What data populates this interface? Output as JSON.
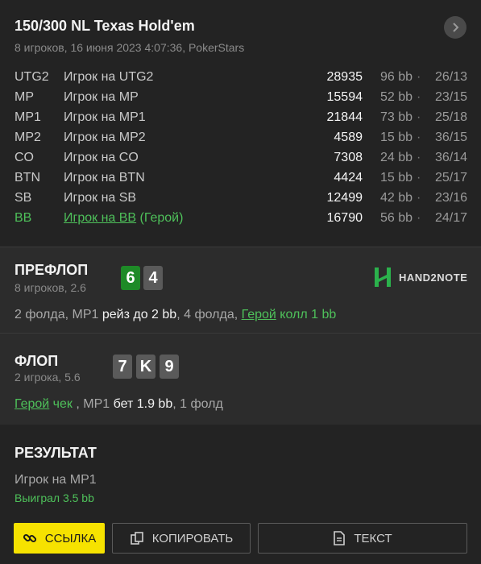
{
  "header": {
    "title": "150/300 NL Texas Hold'em",
    "subtitle": "8 игроков, 16 июня 2023 4:07:36, PokerStars",
    "next_icon": "chevron-right-icon"
  },
  "players": [
    {
      "pos": "UTG2",
      "name": "Игрок на UTG2",
      "hero_tag": "",
      "stack": "28935",
      "bb": "96 bb",
      "stat": "26/13"
    },
    {
      "pos": "MP",
      "name": "Игрок на MP",
      "hero_tag": "",
      "stack": "15594",
      "bb": "52 bb",
      "stat": "23/15"
    },
    {
      "pos": "MP1",
      "name": "Игрок на MP1",
      "hero_tag": "",
      "stack": "21844",
      "bb": "73 bb",
      "stat": "25/18"
    },
    {
      "pos": "MP2",
      "name": "Игрок на MP2",
      "hero_tag": "",
      "stack": "4589",
      "bb": "15 bb",
      "stat": "36/15"
    },
    {
      "pos": "CO",
      "name": "Игрок на CO",
      "hero_tag": "",
      "stack": "7308",
      "bb": "24 bb",
      "stat": "36/14"
    },
    {
      "pos": "BTN",
      "name": "Игрок на BTN",
      "hero_tag": "",
      "stack": "4424",
      "bb": "15 bb",
      "stat": "25/17"
    },
    {
      "pos": "SB",
      "name": "Игрок на SB",
      "hero_tag": "",
      "stack": "12499",
      "bb": "42 bb",
      "stat": "23/16"
    },
    {
      "pos": "BB",
      "name": "Игрок на BB",
      "hero_tag": " (Герой)",
      "stack": "16790",
      "bb": "56 bb",
      "stat": "24/17"
    }
  ],
  "stat_separator": "·",
  "preflop": {
    "title": "ПРЕФЛОП",
    "sub": "8 игроков, 2.6",
    "cards": [
      "6",
      "4"
    ],
    "logo_text": "HAND2NOTE",
    "actions": {
      "a1": "2 фолда, MP1 ",
      "a2": "рейз до 2 bb",
      "a3": ", 4 фолда, ",
      "a4": "Герой",
      "a5": " колл 1 bb"
    }
  },
  "flop": {
    "title": "ФЛОП",
    "sub": "2 игрока, 5.6",
    "cards": [
      "7",
      "K",
      "9"
    ],
    "actions": {
      "a1": "Герой",
      "a2": " чек",
      "a3": " , MP1 ",
      "a4": "бет 1.9 bb",
      "a5": ", 1 фолд"
    }
  },
  "result": {
    "title": "РЕЗУЛЬТАТ",
    "player": "Игрок на MP1",
    "won": "Выиграл 3.5 bb"
  },
  "buttons": {
    "link": "ССЫЛКА",
    "copy": "КОПИРОВАТЬ",
    "text": "ТЕКСТ"
  },
  "colors": {
    "accent_green": "#4ec05a",
    "card_green": "#1e8a27",
    "button_yellow": "#f6e200"
  }
}
